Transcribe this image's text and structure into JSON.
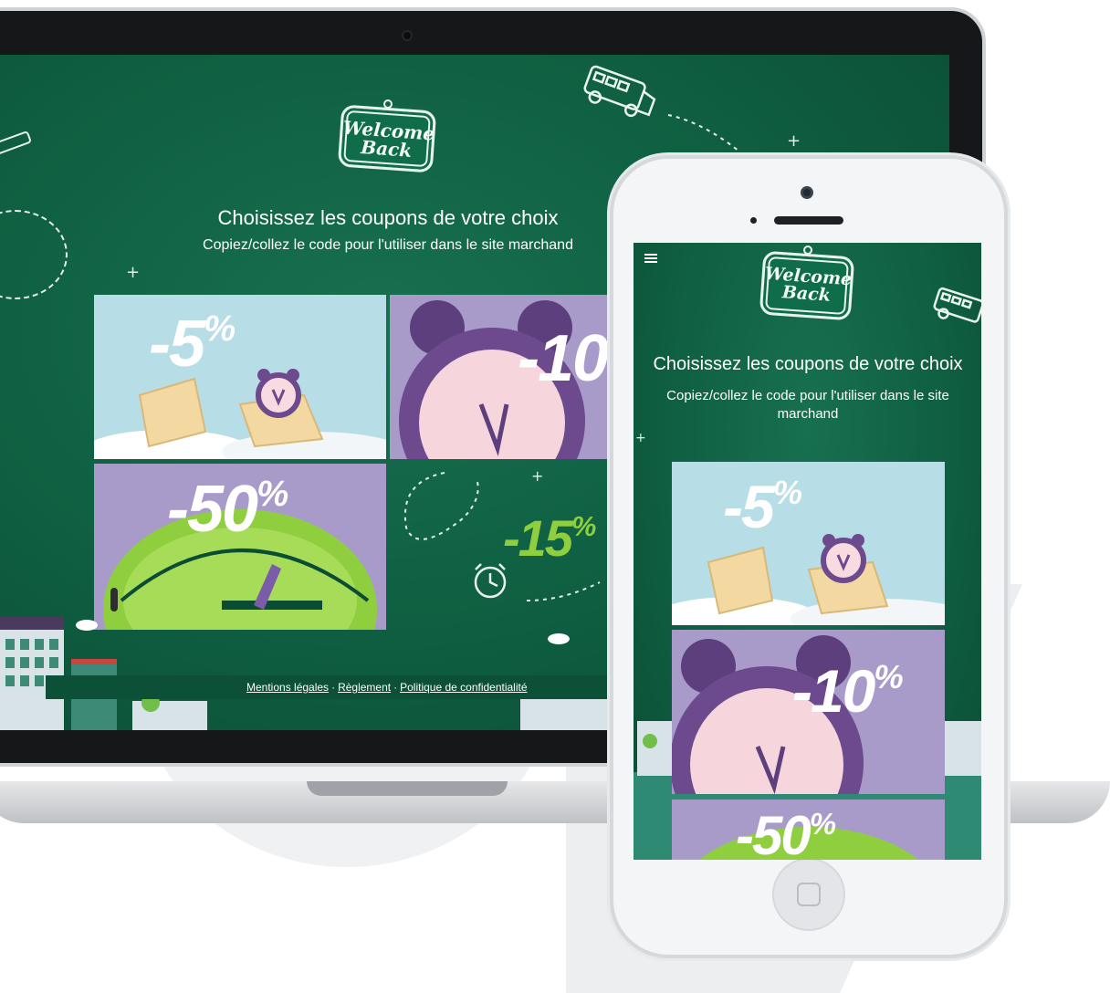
{
  "desktop": {
    "sign": {
      "line1": "Welcome",
      "line2": "Back"
    },
    "title": "Choisissez les coupons de votre choix",
    "subtitle": "Copiez/collez le code pour l'utiliser dans le site marchand",
    "coupons": [
      {
        "value": "-5",
        "unit": "%",
        "bg": "#b7dde6"
      },
      {
        "value": "-10",
        "unit": "%",
        "bg": "#a89bc9"
      },
      {
        "value": "-50",
        "unit": "%",
        "bg": "#a89bc9"
      },
      {
        "value": "-15",
        "unit": "%",
        "bg": "transparent"
      }
    ],
    "footer": {
      "mentions": "Mentions légales",
      "separator": "·",
      "reglement": "Règlement",
      "politique": "Politique de confidentialité"
    }
  },
  "mobile": {
    "menu_icon": "hamburger-icon",
    "sign": {
      "line1": "Welcome",
      "line2": "Back"
    },
    "title": "Choisissez les coupons de votre choix",
    "subtitle": "Copiez/collez le code pour l'utiliser dans le site marchand",
    "coupons": [
      {
        "value": "-5",
        "unit": "%"
      },
      {
        "value": "-10",
        "unit": "%"
      },
      {
        "value": "-50",
        "unit": "%"
      }
    ]
  },
  "colors": {
    "chalkboard": "#0f5e41",
    "sky_blue": "#b7dde6",
    "lavender": "#a89bc9",
    "green_accent": "#8fcf3f"
  }
}
